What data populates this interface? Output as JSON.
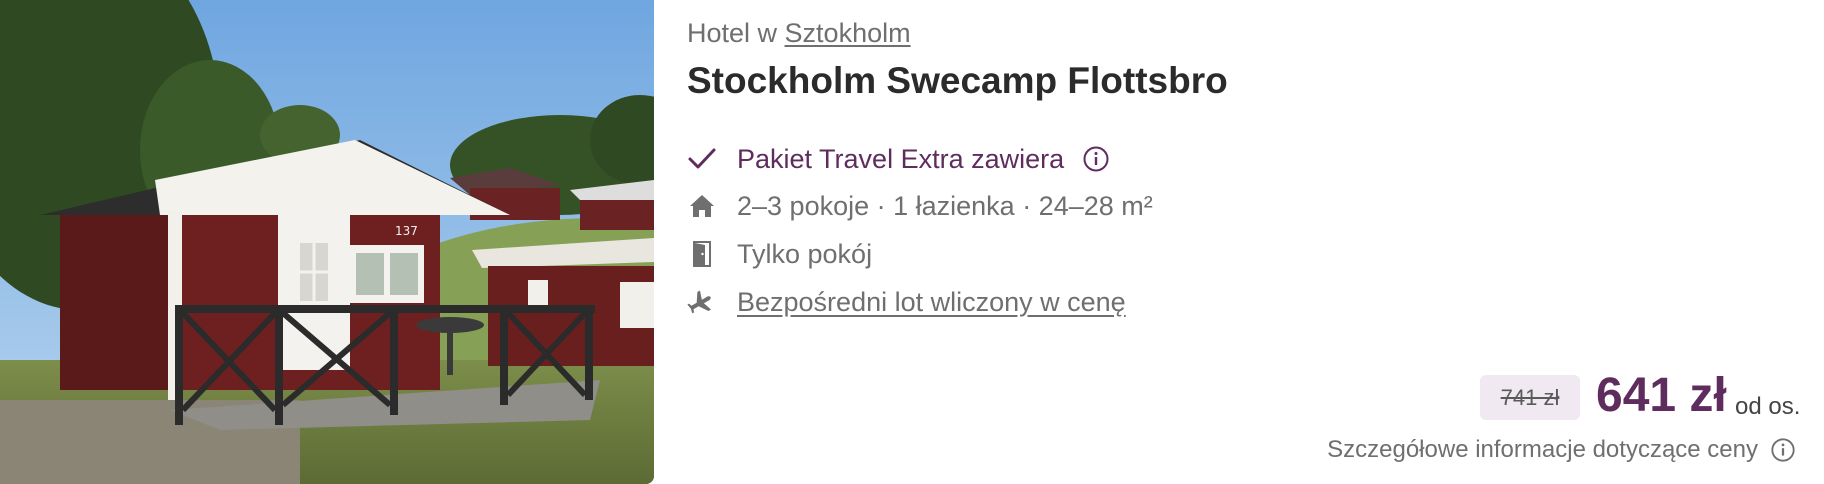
{
  "hotel": {
    "prefix": "Hotel w",
    "city": "Sztokholm",
    "name": "Stockholm Swecamp Flottsbro",
    "image_alt_icon": "photo-cabin"
  },
  "features": [
    {
      "icon": "check-icon",
      "label": "Pakiet Travel Extra zawiera",
      "info_icon": "info-icon"
    },
    {
      "icon": "house-icon",
      "label": "2–3 pokoje · 1 łazienka · 24–28 m²"
    },
    {
      "icon": "door-icon",
      "label": "Tylko pokój"
    },
    {
      "icon": "plane-icon",
      "label": "Bezpośredni lot wliczony w cenę"
    }
  ],
  "price": {
    "old": "741 zł",
    "current": "641 zł",
    "unit": "od os.",
    "details_link": "Szczegółowe informacje dotyczące ceny"
  },
  "colors": {
    "accent": "#5e2d5e",
    "muted_text": "#6f6f6f",
    "old_price_bg": "#f0e9f1"
  }
}
